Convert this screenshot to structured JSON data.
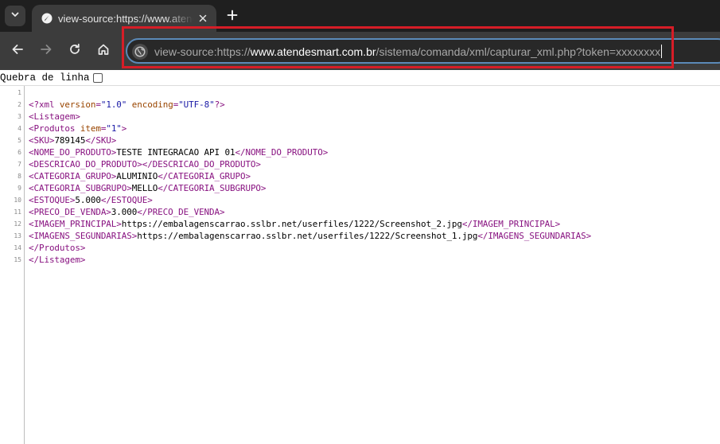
{
  "tab": {
    "title": "view-source:https://www.atendesmart.com.br/sistema/comanda/xml/capturar_xml.php?token=xxxxxxxx"
  },
  "address": {
    "prefix": "view-source:https://",
    "host": "www.atendesmart.com.br",
    "path": "/sistema/comanda/xml/capturar_xml.php?token=xxxxxxxx"
  },
  "wrap": {
    "label": "Quebra de linha",
    "checked": false
  },
  "lines": [
    {
      "n": "1",
      "segs": []
    },
    {
      "n": "2",
      "segs": [
        {
          "c": "pi",
          "t": "<?xml "
        },
        {
          "c": "attr",
          "t": "version"
        },
        {
          "c": "pi",
          "t": "="
        },
        {
          "c": "val",
          "t": "\"1.0\""
        },
        {
          "c": "pi",
          "t": " "
        },
        {
          "c": "attr",
          "t": "encoding"
        },
        {
          "c": "pi",
          "t": "="
        },
        {
          "c": "val",
          "t": "\"UTF-8\""
        },
        {
          "c": "pi",
          "t": "?>"
        }
      ]
    },
    {
      "n": "3",
      "segs": [
        {
          "c": "tag",
          "t": "<Listagem>"
        }
      ]
    },
    {
      "n": "4",
      "segs": [
        {
          "c": "tag",
          "t": "<Produtos "
        },
        {
          "c": "attr",
          "t": "item"
        },
        {
          "c": "tag",
          "t": "="
        },
        {
          "c": "val",
          "t": "\"1\""
        },
        {
          "c": "tag",
          "t": ">"
        }
      ]
    },
    {
      "n": "5",
      "segs": [
        {
          "c": "tag",
          "t": "<SKU>"
        },
        {
          "c": "txt",
          "t": "789145"
        },
        {
          "c": "tag",
          "t": "</SKU>"
        }
      ]
    },
    {
      "n": "6",
      "segs": [
        {
          "c": "tag",
          "t": "<NOME_DO_PRODUTO>"
        },
        {
          "c": "txt",
          "t": "TESTE INTEGRACAO API 01"
        },
        {
          "c": "tag",
          "t": "</NOME_DO_PRODUTO>"
        }
      ]
    },
    {
      "n": "7",
      "segs": [
        {
          "c": "tag",
          "t": "<DESCRICAO_DO_PRODUTO></DESCRICAO_DO_PRODUTO>"
        }
      ]
    },
    {
      "n": "8",
      "segs": [
        {
          "c": "tag",
          "t": "<CATEGORIA_GRUPO>"
        },
        {
          "c": "txt",
          "t": "ALUMINIO"
        },
        {
          "c": "tag",
          "t": "</CATEGORIA_GRUPO>"
        }
      ]
    },
    {
      "n": "9",
      "segs": [
        {
          "c": "tag",
          "t": "<CATEGORIA_SUBGRUPO>"
        },
        {
          "c": "txt",
          "t": "MELLO"
        },
        {
          "c": "tag",
          "t": "</CATEGORIA_SUBGRUPO>"
        }
      ]
    },
    {
      "n": "10",
      "segs": [
        {
          "c": "tag",
          "t": "<ESTOQUE>"
        },
        {
          "c": "txt",
          "t": "5.000"
        },
        {
          "c": "tag",
          "t": "</ESTOQUE>"
        }
      ]
    },
    {
      "n": "11",
      "segs": [
        {
          "c": "tag",
          "t": "<PRECO_DE_VENDA>"
        },
        {
          "c": "txt",
          "t": "3.000"
        },
        {
          "c": "tag",
          "t": "</PRECO_DE_VENDA>"
        }
      ]
    },
    {
      "n": "12",
      "segs": [
        {
          "c": "tag",
          "t": "<IMAGEM_PRINCIPAL>"
        },
        {
          "c": "txt",
          "t": "https://embalagenscarrao.sslbr.net/userfiles/1222/Screenshot_2.jpg"
        },
        {
          "c": "tag",
          "t": "</IMAGEM_PRINCIPAL>"
        }
      ]
    },
    {
      "n": "13",
      "segs": [
        {
          "c": "tag",
          "t": "<IMAGENS_SEGUNDARIAS>"
        },
        {
          "c": "txt",
          "t": "https://embalagenscarrao.sslbr.net/userfiles/1222/Screenshot_1.jpg"
        },
        {
          "c": "tag",
          "t": "</IMAGENS_SEGUNDARIAS>"
        }
      ]
    },
    {
      "n": "14",
      "segs": [
        {
          "c": "tag",
          "t": "</Produtos>"
        }
      ]
    },
    {
      "n": "15",
      "segs": [
        {
          "c": "tag",
          "t": "</Listagem>"
        }
      ]
    }
  ]
}
